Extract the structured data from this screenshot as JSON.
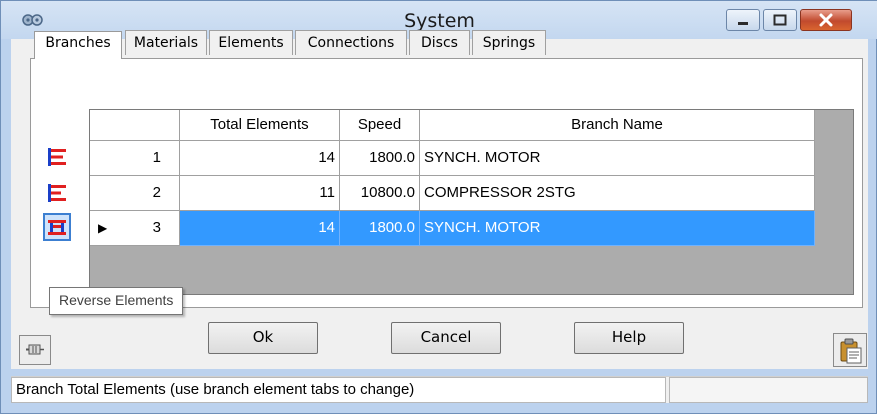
{
  "window": {
    "title": "System"
  },
  "tabs": [
    {
      "label": "Branches",
      "active": true
    },
    {
      "label": "Materials",
      "active": false
    },
    {
      "label": "Elements",
      "active": false
    },
    {
      "label": "Connections",
      "active": false
    },
    {
      "label": "Discs",
      "active": false
    },
    {
      "label": "Springs",
      "active": false
    }
  ],
  "grid": {
    "columns": [
      "",
      "Total Elements",
      "Speed",
      "Branch Name"
    ],
    "rows": [
      {
        "num": "1",
        "total_elements": "14",
        "speed": "1800.0",
        "branch_name": "SYNCH. MOTOR",
        "selected": false
      },
      {
        "num": "2",
        "total_elements": "11",
        "speed": "10800.0",
        "branch_name": "COMPRESSOR 2STG",
        "selected": false
      },
      {
        "num": "3",
        "total_elements": "14",
        "speed": "1800.0",
        "branch_name": "SYNCH. MOTOR",
        "selected": true
      }
    ],
    "current_row_marker": "▶"
  },
  "side_icons": [
    "add-branch-icon",
    "insert-branch-icon",
    "reverse-elements-icon"
  ],
  "tooltip": {
    "text": "Reverse Elements"
  },
  "buttons": {
    "ok": "Ok",
    "cancel": "Cancel",
    "help": "Help"
  },
  "status": {
    "text": "Branch Total Elements (use branch element tabs to change)"
  },
  "colors": {
    "selection": "#3399ff",
    "title_bar": "#c8daf0",
    "close_button": "#c94c30",
    "icon_red": "#e02020",
    "icon_blue": "#1a3fc8"
  }
}
